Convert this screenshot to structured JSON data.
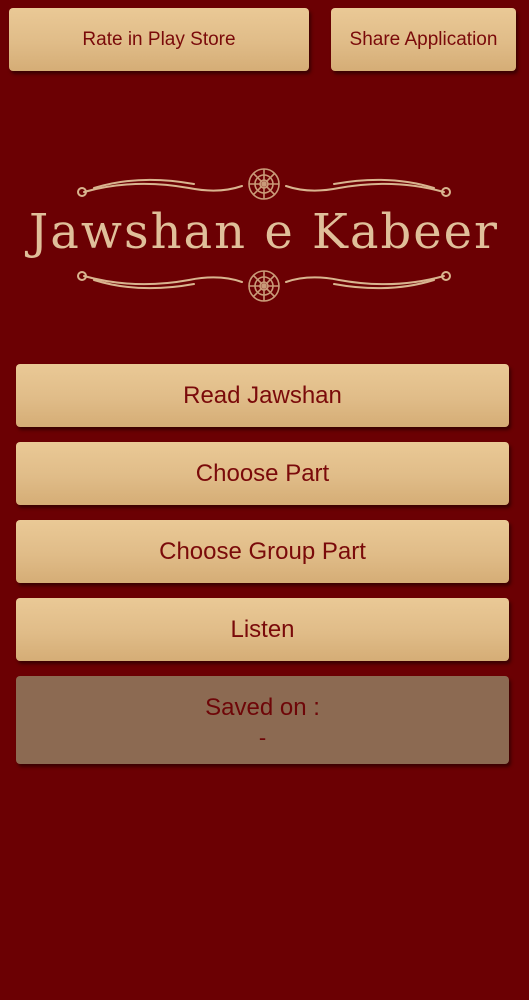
{
  "header": {
    "rate_label": "Rate in Play Store",
    "share_label": "Share Application"
  },
  "logo": {
    "title": "Jawshan e Kabeer"
  },
  "menu": {
    "read_label": "Read Jawshan",
    "part_label": "Choose Part",
    "group_label": "Choose Group Part",
    "listen_label": "Listen"
  },
  "saved": {
    "label": "Saved on :",
    "value": "-"
  },
  "colors": {
    "background": "#6b0003",
    "button": "#e0bc88",
    "button_text": "#7a0a0a",
    "saved_panel": "#8c6a52",
    "logo_text": "#e0bf9a"
  }
}
